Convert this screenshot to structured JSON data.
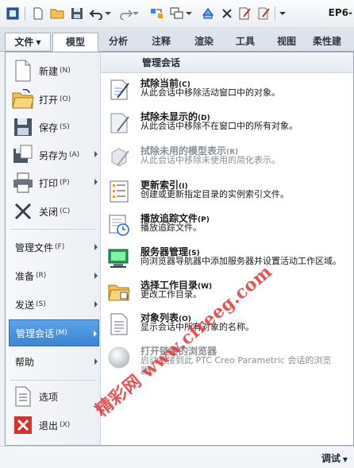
{
  "app_title": "EP6-",
  "ribbon": {
    "file_tab": "文件",
    "tabs": [
      "模型",
      "分析",
      "注释",
      "渲染",
      "工具",
      "视图",
      "柔性建"
    ]
  },
  "left_menu": {
    "items": [
      {
        "label": "新建",
        "key": "(N)"
      },
      {
        "label": "打开",
        "key": "(O)"
      },
      {
        "label": "保存",
        "key": "(S)"
      },
      {
        "label": "另存为",
        "key": "(A)"
      },
      {
        "label": "打印",
        "key": "(P)"
      },
      {
        "label": "关闭",
        "key": "(C)"
      }
    ],
    "text_items": [
      {
        "label": "管理文件",
        "key": "(F)"
      },
      {
        "label": "准备",
        "key": "(R)"
      },
      {
        "label": "发送",
        "key": "(S)"
      },
      {
        "label": "管理会话",
        "key": "(M)"
      },
      {
        "label": "帮助",
        "key": ""
      }
    ],
    "bottom_items": [
      {
        "label": "选项",
        "key": ""
      },
      {
        "label": "退出",
        "key": "(X)"
      }
    ]
  },
  "submenu": {
    "header": "管理会话",
    "items": [
      {
        "title": "拭除当前",
        "key": "(C)",
        "desc": "从此会话中移除活动窗口中的对象。"
      },
      {
        "title": "拭除未显示的",
        "key": "(D)",
        "desc": "从此会话中移除不在窗口中的所有对象。"
      },
      {
        "title": "拭除未用的模型表示",
        "key": "(R)",
        "desc": "从此会话中移除未使用的简化表示。"
      },
      {
        "title": "更新索引",
        "key": "(I)",
        "desc": "创建或更新指定目录的实例索引文件。"
      },
      {
        "title": "播放追踪文件",
        "key": "(P)",
        "desc": "播放追踪文件。"
      },
      {
        "title": "服务器管理",
        "key": "(S)",
        "desc": "向浏览器导航器中添加服务器并设置活动工作区域。"
      },
      {
        "title": "选择工作目录",
        "key": "(W)",
        "desc": "更改工作目录。"
      },
      {
        "title": "对象列表",
        "key": "(O)",
        "desc": "显示会话中所有对象的名称。"
      },
      {
        "title": "打开链接的浏览器",
        "key": "",
        "desc": "启动链接到此 PTC Creo Parametric 会话的浏览器。"
      }
    ]
  },
  "watermark": "精彩网 www.cfreeg.com",
  "status": {
    "debug_label": "调试"
  },
  "colors": {
    "selected": "#3b84d6",
    "close_red": "#d9302c",
    "watermark": "#e23b3b"
  }
}
